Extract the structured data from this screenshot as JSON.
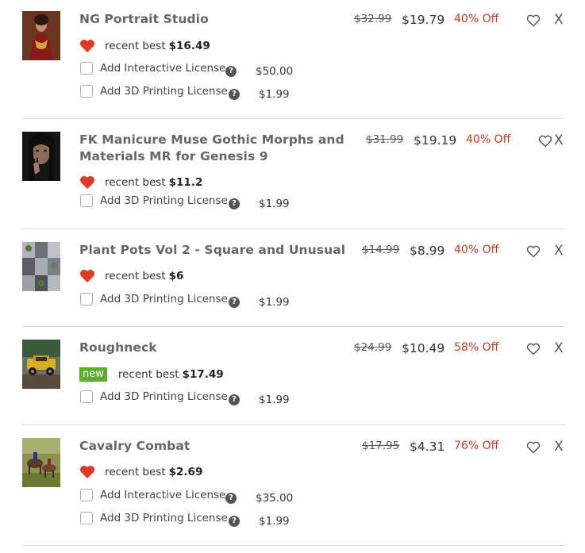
{
  "items": [
    {
      "title": "NG Portrait Studio",
      "old_price": "$32.99",
      "price": "$19.79",
      "discount": "40% Off",
      "badge": "",
      "recent_label": "recent best",
      "recent_value": "$16.49",
      "remove_label": "X",
      "licenses": [
        {
          "label": "Add Interactive License",
          "help": "?",
          "price": "$50.00"
        },
        {
          "label": "Add 3D Printing License",
          "help": "?",
          "price": "$1.99"
        }
      ]
    },
    {
      "title_line1": "FK Manicure Muse Gothic Morphs and",
      "title_line2": "Materials MR for Genesis 9",
      "old_price": "$31.99",
      "price": "$19.19",
      "discount": "40% Off",
      "recent_label": "recent best",
      "recent_value": "$11.2",
      "remove_label": "X",
      "licenses": [
        {
          "label": "Add 3D Printing License",
          "help": "?",
          "price": "$1.99"
        }
      ]
    },
    {
      "title": "Plant Pots Vol 2 - Square and Unusual",
      "old_price": "$14.99",
      "price": "$8.99",
      "discount": "40% Off",
      "recent_label": "recent best",
      "recent_value": "$6",
      "remove_label": "X",
      "licenses": [
        {
          "label": "Add 3D Printing License",
          "help": "?",
          "price": "$1.99"
        }
      ]
    },
    {
      "title": "Roughneck",
      "old_price": "$24.99",
      "price": "$10.49",
      "discount": "58% Off",
      "badge": "new",
      "recent_label": "recent best",
      "recent_value": "$17.49",
      "remove_label": "X",
      "licenses": [
        {
          "label": "Add 3D Printing License",
          "help": "?",
          "price": "$1.99"
        }
      ]
    },
    {
      "title": "Cavalry Combat",
      "old_price": "$17.95",
      "price": "$4.31",
      "discount": "76% Off",
      "recent_label": "recent best",
      "recent_value": "$2.69",
      "remove_label": "X",
      "licenses": [
        {
          "label": "Add Interactive License",
          "help": "?",
          "price": "$35.00"
        },
        {
          "label": "Add 3D Printing License",
          "help": "?",
          "price": "$1.99"
        }
      ]
    }
  ],
  "colors": {
    "discount": "#cc3a1f",
    "heart": "#e03a22",
    "new_badge": "#5cae2c",
    "divider": "#dedede"
  }
}
